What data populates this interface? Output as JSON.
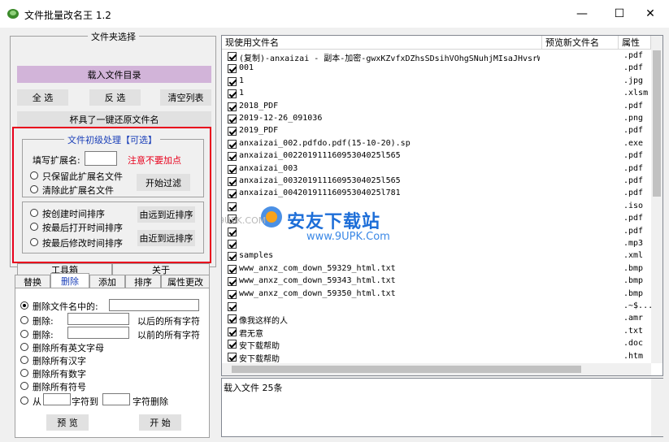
{
  "window": {
    "title": "文件批量改名王 1.2",
    "min": "—",
    "max": "☐",
    "close": "✕"
  },
  "folder": {
    "legend": "文件夹选择",
    "load_button": "载入文件目录",
    "select_all": "全 选",
    "invert": "反 选",
    "clear": "清空列表",
    "restore": "杯具了一键还原文件名"
  },
  "prep": {
    "legend": "文件初级处理【可选】",
    "ext_label": "填写扩展名:",
    "ext_value": "",
    "warning": "注意不要加点",
    "keep_ext": "只保留此扩展名文件",
    "clear_ext": "清除此扩展名文件",
    "filter_button": "开始过滤",
    "sort_create": "按创建时间排序",
    "sort_open": "按最后打开时间排序",
    "sort_modify": "按最后修改时间排序",
    "far_to_near": "由远到近排序",
    "near_to_far": "由近到远排序"
  },
  "tabs": {
    "row1": [
      "工具箱",
      "关于"
    ],
    "row2": [
      "替换",
      "删除",
      "添加",
      "排序",
      "属性更改"
    ]
  },
  "delete": {
    "opt_delete_in_name": "删除文件名中的:",
    "opt_delete_after": "删除:",
    "after_suffix": "以后的所有字符",
    "opt_delete_before": "删除:",
    "before_suffix": "以前的所有字符",
    "opt_english": "删除所有英文字母",
    "opt_chinese": "删除所有汉字",
    "opt_digits": "删除所有数字",
    "opt_symbols": "删除所有符号",
    "opt_from": "从",
    "char_to": "字符到",
    "char_delete": "字符删除",
    "preview": "预 览",
    "start": "开 始"
  },
  "list": {
    "headers": [
      "现使用文件名",
      "预览新文件名",
      "属性"
    ],
    "rows": [
      {
        "name": "(复制)-anxaizai - 副本-加密-gwxKZvfxDZhsSDsihVOhgSNuhjMIsaJHvsrWJv",
        "ext": ".pdf"
      },
      {
        "name": "001",
        "ext": ".pdf"
      },
      {
        "name": "1",
        "ext": ".jpg"
      },
      {
        "name": "1",
        "ext": ".xlsm"
      },
      {
        "name": "2018_PDF",
        "ext": ".pdf"
      },
      {
        "name": "2019-12-26_091036",
        "ext": ".png"
      },
      {
        "name": "2019_PDF",
        "ext": ".pdf"
      },
      {
        "name": "anxaizai_002.pdfdo.pdf(15-10-20).sp",
        "ext": ".exe"
      },
      {
        "name": "anxaizai_00220191116095304025l565",
        "ext": ".pdf"
      },
      {
        "name": "anxaizai_003",
        "ext": ".pdf"
      },
      {
        "name": "anxaizai_00320191116095304025l565",
        "ext": ".pdf"
      },
      {
        "name": "anxaizai_00420191116095304025l781",
        "ext": ".pdf"
      },
      {
        "name": "",
        "ext": ".iso"
      },
      {
        "name": "",
        "ext": ".pdf"
      },
      {
        "name": "",
        "ext": ".pdf"
      },
      {
        "name": "",
        "ext": ".mp3"
      },
      {
        "name": "samples",
        "ext": ".xml"
      },
      {
        "name": "www_anxz_com_down_59329_html.txt",
        "ext": ".bmp"
      },
      {
        "name": "www_anxz_com_down_59343_html.txt",
        "ext": ".bmp"
      },
      {
        "name": "www_anxz_com_down_59350_html.txt",
        "ext": ".bmp"
      },
      {
        "name": "",
        "ext": ".~$..."
      },
      {
        "name": "像我这样的人",
        "ext": ".amr"
      },
      {
        "name": "君无意",
        "ext": ".txt"
      },
      {
        "name": "安下载帮助",
        "ext": ".doc"
      },
      {
        "name": "安下载帮助",
        "ext": ".htm"
      }
    ]
  },
  "log": {
    "text": "载入文件  25条"
  },
  "watermark": {
    "text": "安友下载站",
    "url": "www.9UPK.Com",
    "short": "9UPK.COM"
  },
  "colors": {
    "load_button": "#d2b4d9",
    "red_box": "#e8001c",
    "warning": "#e8001c",
    "blue_legend": "#1a3fb8"
  }
}
